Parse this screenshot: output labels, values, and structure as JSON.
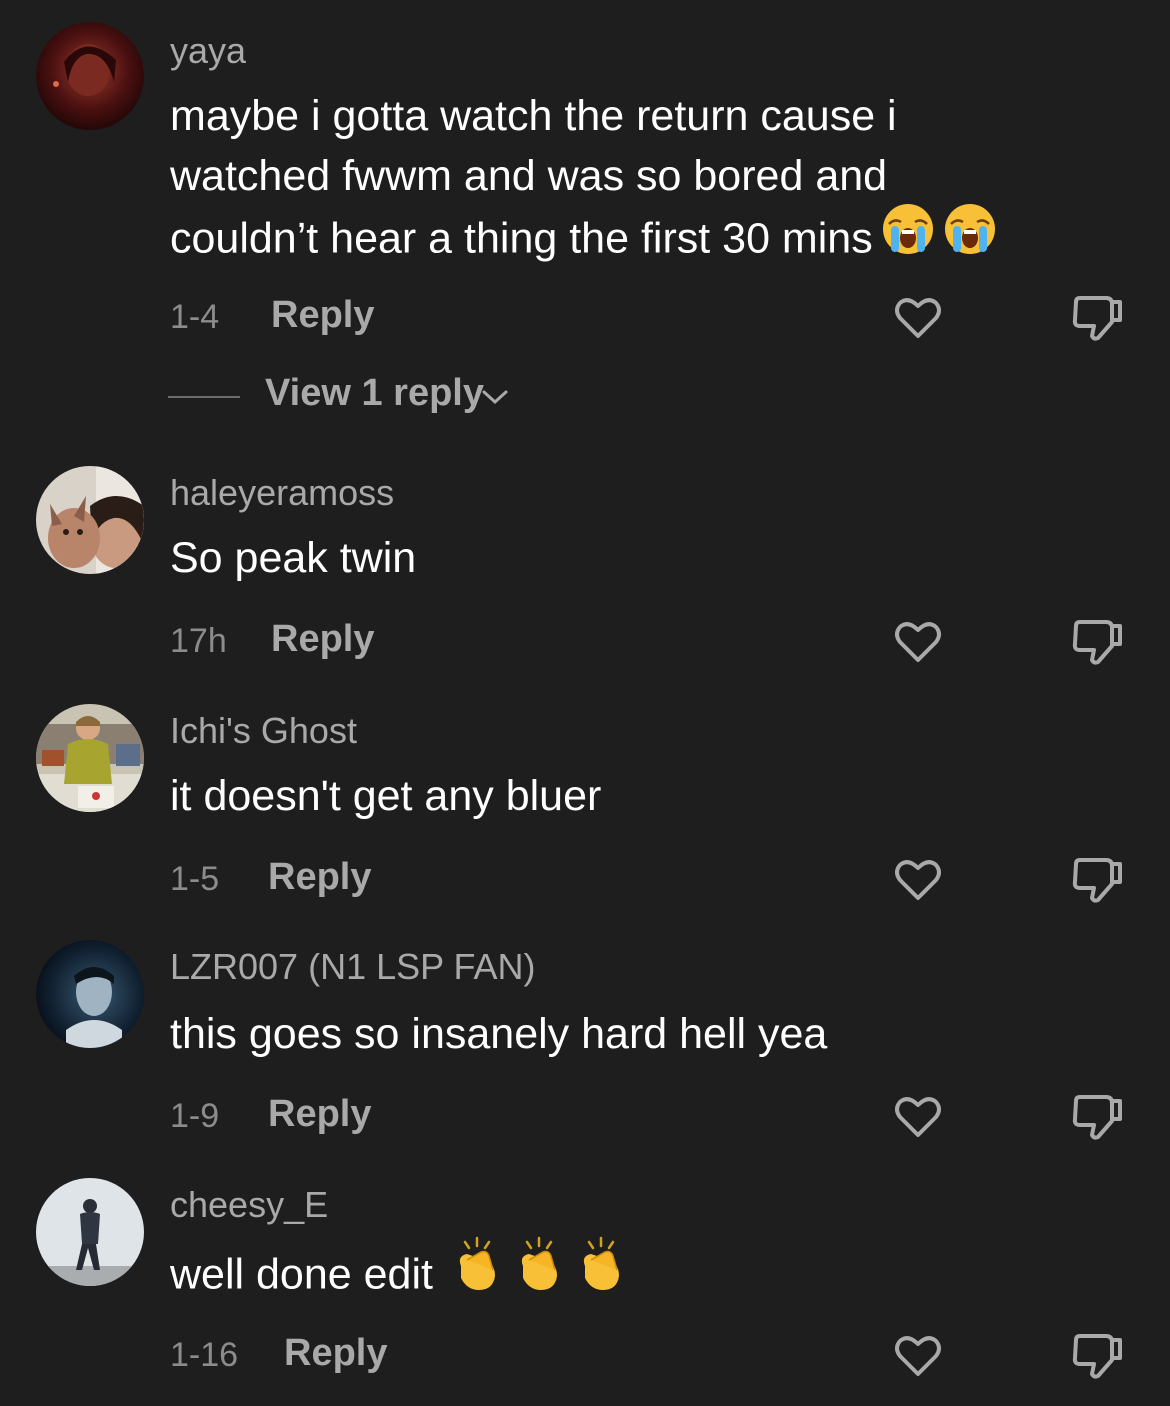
{
  "comments": [
    {
      "username": "yaya",
      "text_lines": [
        "maybe i gotta watch the return cause i",
        "watched fwwm and was so bored and",
        "couldn’t hear a thing the first 30 mins"
      ],
      "emoji": "😭😭",
      "time": "1-4",
      "reply_label": "Reply",
      "view_replies_label": "View 1 reply"
    },
    {
      "username": "haleyeramoss",
      "text_lines": [
        "So peak twin"
      ],
      "time": "17h",
      "reply_label": "Reply"
    },
    {
      "username": "Ichi's Ghost",
      "text_lines": [
        "it doesn't get any bluer"
      ],
      "time": "1-5",
      "reply_label": "Reply"
    },
    {
      "username": "LZR007 (N1 LSP FAN)",
      "text_lines": [
        "this goes so insanely hard hell yea"
      ],
      "time": "1-9",
      "reply_label": "Reply"
    },
    {
      "username": "cheesy_E",
      "text_lines": [
        "well done edit"
      ],
      "emoji": "👏👏👏",
      "time": "1-16",
      "reply_label": "Reply"
    }
  ],
  "icons": {
    "like": "heart-outline-icon",
    "dislike": "thumbs-down-outline-icon",
    "expand": "chevron-down-icon"
  },
  "colors": {
    "background": "#1e1e1e",
    "username": "#a9a9a9",
    "text": "#ffffff",
    "meta": "#8c8c8c"
  }
}
